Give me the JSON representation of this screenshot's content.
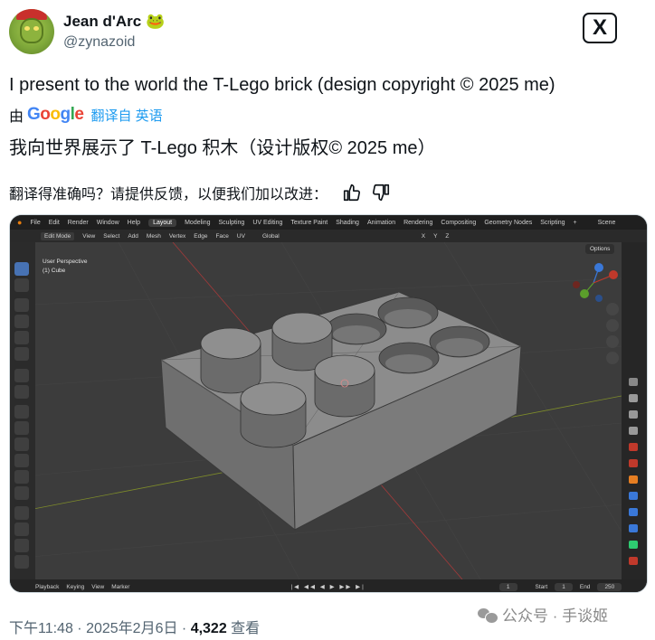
{
  "author": {
    "name": "Jean d'Arc",
    "name_emoji": "🐸",
    "handle": "@zynazoid"
  },
  "x_logo_label": "X",
  "tweet": {
    "text": "I present to the world the T-Lego brick (design copyright © 2025 me)",
    "translated_by_prefix": "由",
    "translated_by_brand": "Google",
    "translated_by_suffix": "翻译自 英语",
    "translated_text": "我向世界展示了 T-Lego 积木（设计版权© 2025 me）",
    "feedback_prompt": "翻译得准确吗？请提供反馈，以便我们加以改进："
  },
  "blender": {
    "menu": [
      "File",
      "Edit",
      "Render",
      "Window",
      "Help"
    ],
    "workspaces": [
      "Layout",
      "Modeling",
      "Sculpting",
      "UV Editing",
      "Texture Paint",
      "Shading",
      "Animation",
      "Rendering",
      "Compositing",
      "Geometry Nodes",
      "Scripting"
    ],
    "active_workspace": "Layout",
    "scene_label": "Scene",
    "header": [
      "Edit Mode",
      "View",
      "Select",
      "Add",
      "Mesh",
      "Vertex",
      "Edge",
      "Face",
      "UV"
    ],
    "transform_orientation": "Global",
    "axis_labels": [
      "X",
      "Y",
      "Z"
    ],
    "viewport_title": "User Perspective",
    "viewport_object": "(1) Cube",
    "options_label": "Options",
    "timeline": [
      "Playback",
      "Keying",
      "View",
      "Marker"
    ],
    "current_frame": "1",
    "start_label": "Start",
    "start_value": "1",
    "end_label": "End",
    "end_value": "250"
  },
  "footer": {
    "time": "下午11:48 · 2025年2月6日 · ",
    "views_count": "4,322",
    "views_label": " 查看"
  },
  "watermark": "公众号 · 手谈姬",
  "colors": {
    "text_primary": "#0f1419",
    "text_secondary": "#536471",
    "link": "#1d9bf0",
    "blender_active_blue": "#4772b3"
  }
}
